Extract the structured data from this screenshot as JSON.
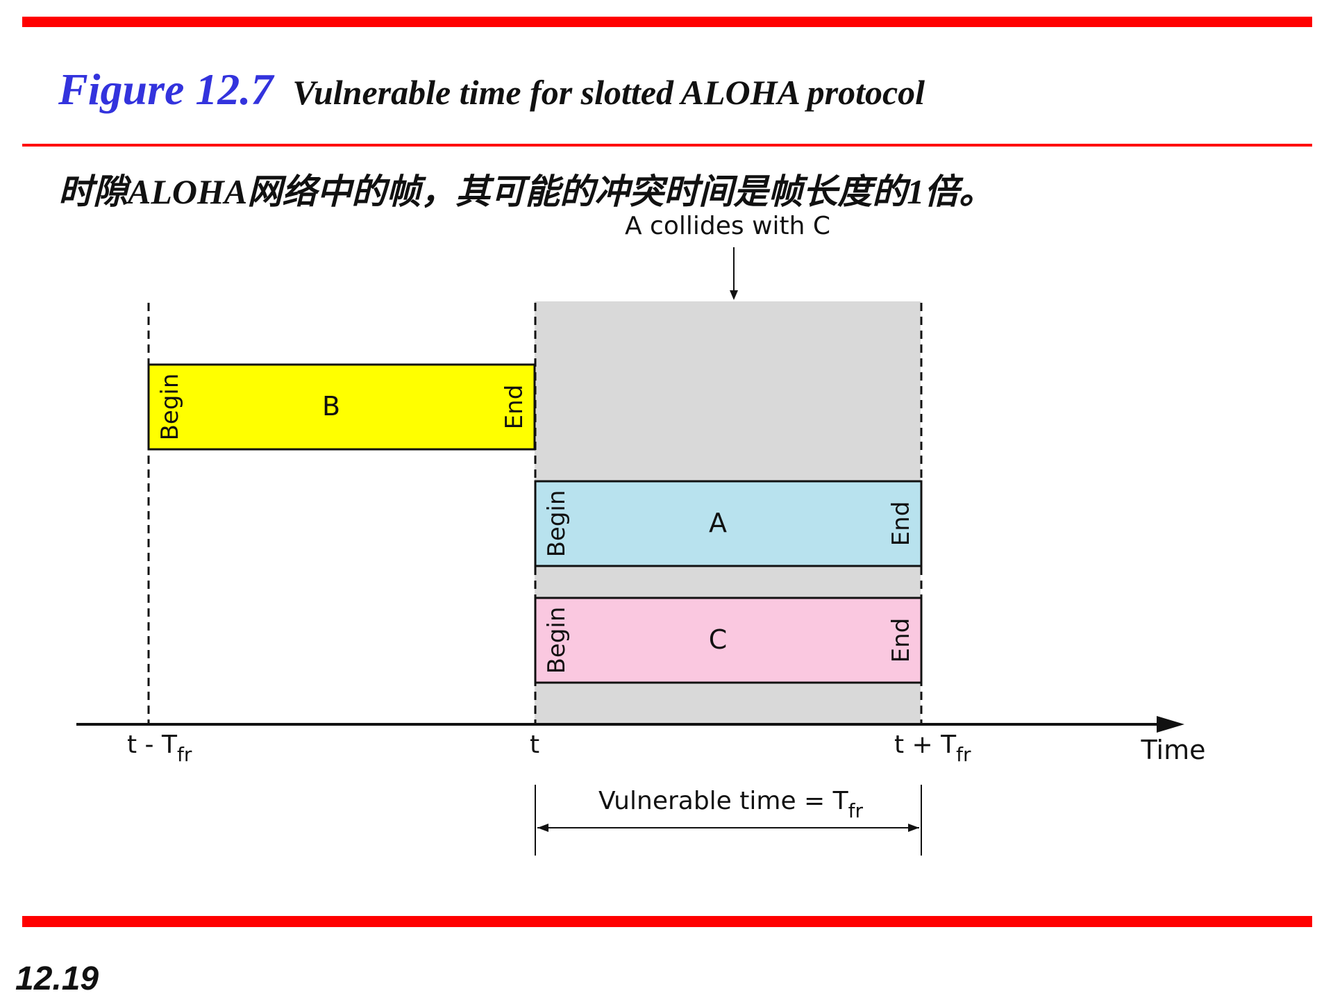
{
  "figure": {
    "label": "Figure 12.7",
    "caption": "Vulnerable time for slotted ALOHA protocol"
  },
  "subtitle": "时隙ALOHA网络中的帧，其可能的冲突时间是帧长度的1倍。",
  "annotation": "A collides with C",
  "frames": [
    {
      "name": "B",
      "begin": "Begin",
      "end": "End",
      "color": "#ffff00"
    },
    {
      "name": "A",
      "begin": "Begin",
      "end": "End",
      "color": "#b8e2ee"
    },
    {
      "name": "C",
      "begin": "Begin",
      "end": "End",
      "color": "#fac8e0"
    }
  ],
  "axis": {
    "label": "Time",
    "ticks": [
      {
        "base": "t - T",
        "sub": "fr"
      },
      {
        "base": "t",
        "sub": ""
      },
      {
        "base": "t + T",
        "sub": "fr"
      }
    ]
  },
  "vulnerable": {
    "base": "Vulnerable time = T",
    "sub": "fr"
  },
  "colors": {
    "rule": "#ff0000",
    "figure_label": "#3333dd",
    "shaded_region": "#d9d9d9"
  },
  "page_number": "12.19"
}
